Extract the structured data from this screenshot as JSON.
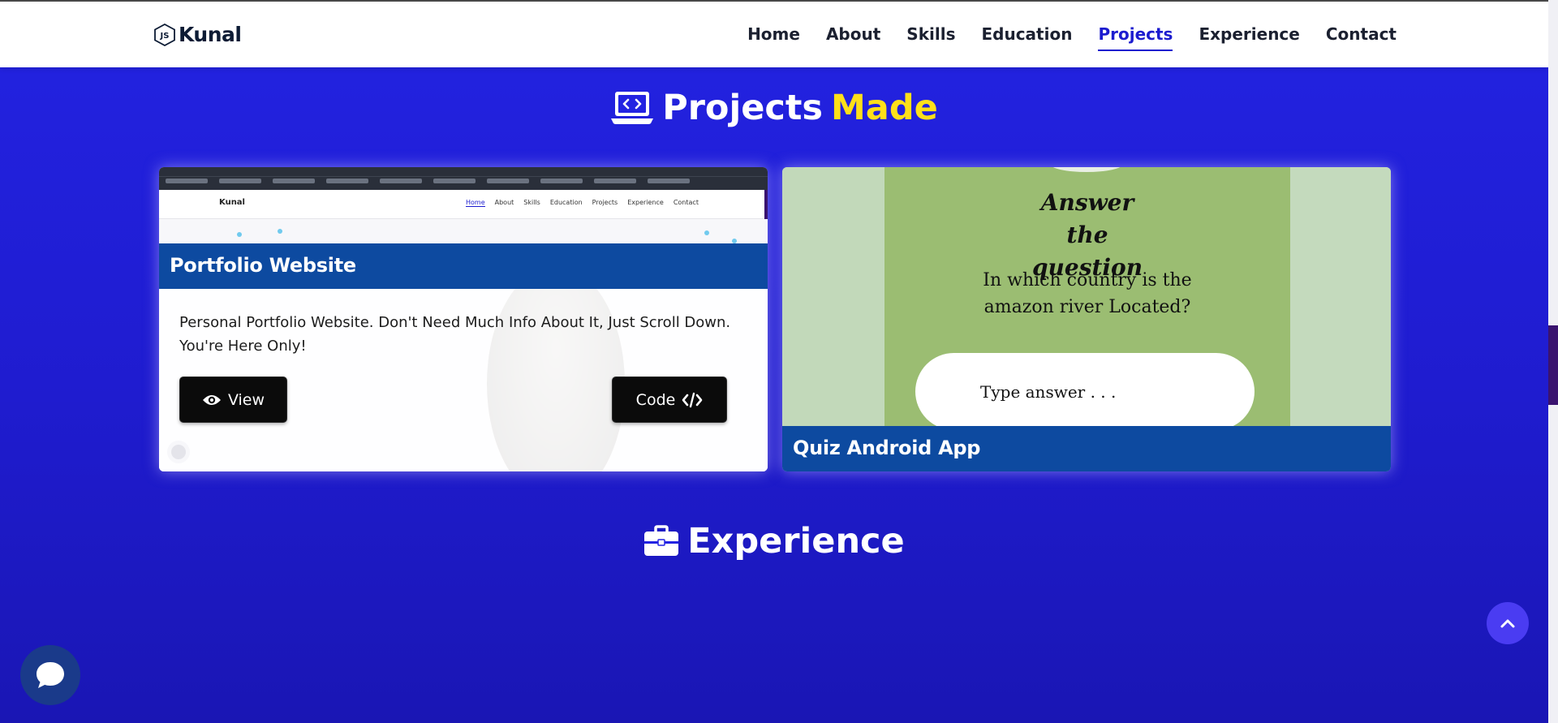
{
  "header": {
    "brand": "Kunal",
    "nav": [
      "Home",
      "About",
      "Skills",
      "Education",
      "Projects",
      "Experience",
      "Contact"
    ],
    "active_nav": "Projects"
  },
  "projects": {
    "title_main": "Projects",
    "title_accent": "Made",
    "cards": [
      {
        "title": "Portfolio Website",
        "description": "Personal Portfolio Website. Don't Need Much Info About It, Just Scroll Down. You're Here Only!",
        "view_label": "View",
        "code_label": "Code"
      },
      {
        "title": "Quiz Android App",
        "preview": {
          "heading": "Answer the question",
          "question": "In which country is the amazon river Located?",
          "input_placeholder": "Type answer . . ."
        }
      }
    ],
    "mini_screenshot": {
      "brand": "Kunal",
      "nav": [
        "Home",
        "About",
        "Skills",
        "Education",
        "Projects",
        "Experience",
        "Contact"
      ]
    }
  },
  "experience": {
    "title": "Experience"
  },
  "colors": {
    "background": "#2323e2",
    "accent": "#ffe019",
    "card_banner": "#0d4aa0",
    "active_nav": "#1c1ccf"
  },
  "icons": {
    "brand": "js-hexagon-icon",
    "projects": "laptop-code-icon",
    "experience": "briefcase-icon",
    "view": "eye-icon",
    "code": "code-icon",
    "scroll_top": "chevron-up-icon",
    "chat": "chat-bubble-icon"
  }
}
